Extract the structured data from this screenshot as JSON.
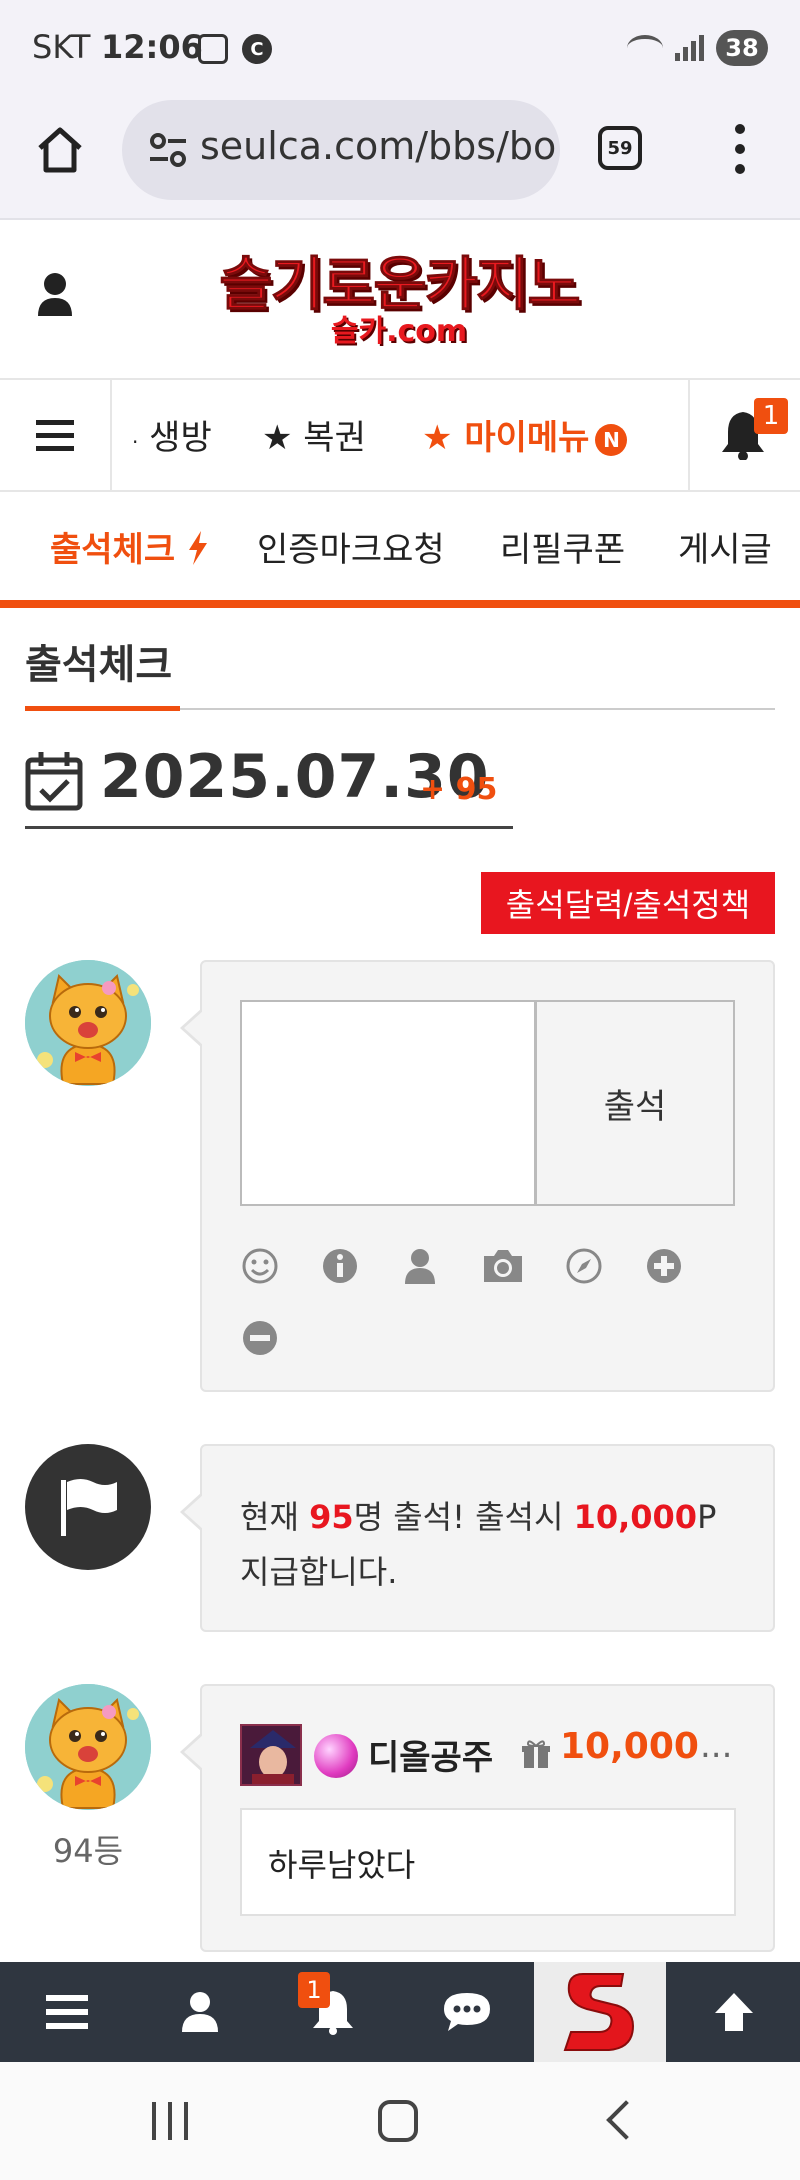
{
  "status_bar": {
    "carrier": "SKT",
    "time": "12:06",
    "sync_letter": "C",
    "battery": "38"
  },
  "browser": {
    "url": "seulca.com/bbs/bo",
    "tab_count": "59"
  },
  "site": {
    "logo_main": "슬기로운카지노",
    "logo_sub": "슬카.com"
  },
  "main_nav": {
    "items": [
      {
        "label": "생방",
        "prefix": "·"
      },
      {
        "label": "★ 복권"
      },
      {
        "label": "★ 마이메뉴",
        "badge": "N"
      }
    ],
    "notification_count": "1"
  },
  "sub_nav": {
    "items": [
      {
        "label": "출석체크",
        "active": true
      },
      {
        "label": "인증마크요청"
      },
      {
        "label": "리필쿠폰"
      },
      {
        "label": "게시글"
      }
    ]
  },
  "page": {
    "title": "출석체크",
    "date": "2025.07.30",
    "attendee_count_label": "+ 95",
    "policy_button": "출석달력/출석정책"
  },
  "attendance_form": {
    "input_value": "",
    "submit_label": "출석",
    "tools": [
      "smile-icon",
      "info-icon",
      "user-icon",
      "camera-icon",
      "compass-icon",
      "plus-circle-icon",
      "minus-circle-icon"
    ]
  },
  "notice": {
    "t1": "현재 ",
    "count": "95",
    "t2": "명 출석! 출석시 ",
    "points": "10,000",
    "t3": "P",
    "t4": "지급합니다."
  },
  "comment": {
    "rank": "94등",
    "username": "디올공주",
    "points": "10,000",
    "more": "...",
    "body": "하루남았다"
  },
  "bottom_bar": {
    "notification_count": "1"
  },
  "colors": {
    "accent": "#f04f0f",
    "red": "#e8161f",
    "dark": "#2f3640"
  }
}
